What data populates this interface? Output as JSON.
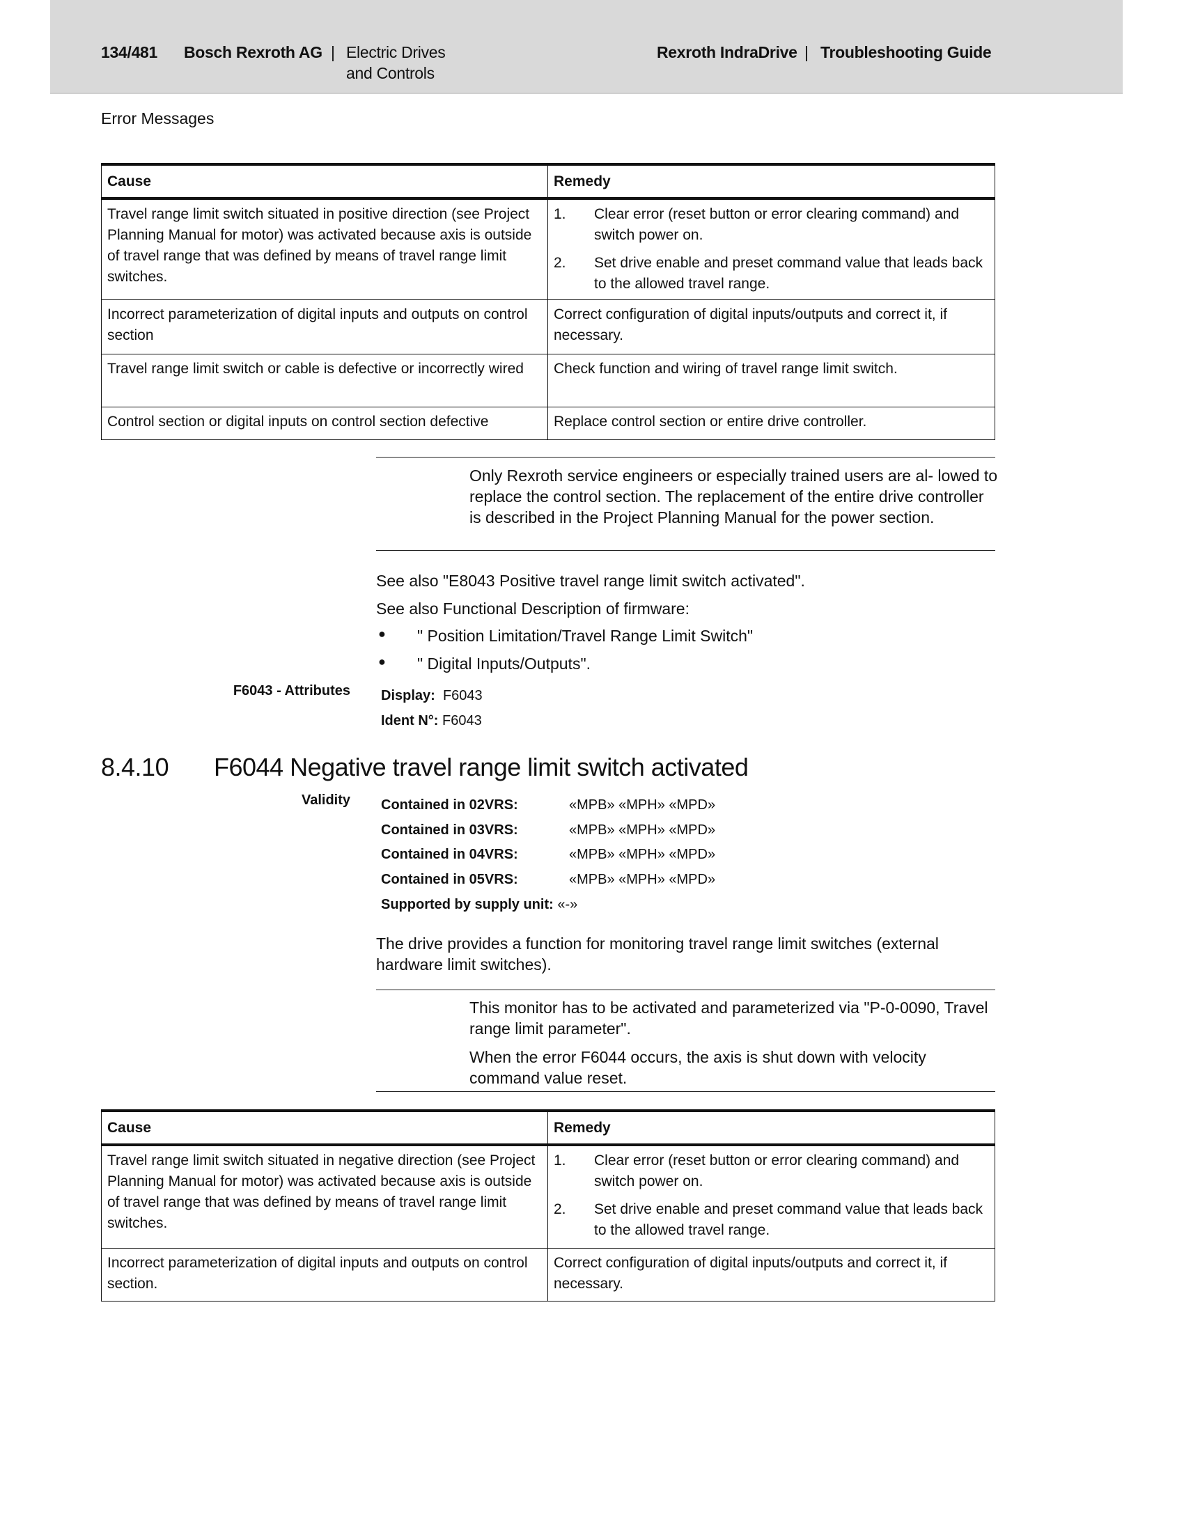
{
  "header": {
    "page": "134/481",
    "company": "Bosch Rexroth AG",
    "separator": "|",
    "division_line1": "Electric Drives",
    "division_line2": "and Controls",
    "product": "Rexroth IndraDrive",
    "doc_title": "Troubleshooting Guide"
  },
  "section_label": "Error Messages",
  "table1": {
    "headers": [
      "Cause",
      "Remedy"
    ],
    "rows": [
      {
        "cause": "Travel range limit switch situated in positive direction (see Project Planning Manual for motor) was activated because axis is outside of travel range that was defined by means of travel range limit switches.",
        "remedy_list": [
          {
            "num": "1.",
            "text": "Clear error (reset button or error clearing command) and switch power on."
          },
          {
            "num": "2.",
            "text": "Set drive enable and preset command value that leads back to the allowed travel range."
          }
        ]
      },
      {
        "cause": "Incorrect parameterization of digital inputs and outputs on control section",
        "remedy": "Correct configuration of digital inputs/outputs and correct it, if necessary."
      },
      {
        "cause": "Travel range limit switch or cable is defective or incorrectly wired",
        "remedy": "Check function and wiring of travel range limit switch."
      },
      {
        "cause": "Control section or digital inputs on control section defective",
        "remedy": "Replace control section or entire drive controller."
      }
    ]
  },
  "note1": "Only Rexroth service engineers or especially trained users are al- lowed to replace the control section. The replacement of the entire drive controller is described in the Project Planning Manual for the power section.",
  "see_also": [
    "See also \"E8043 Positive travel range limit switch activated\".",
    "See also Functional Description of firmware:"
  ],
  "bullets": [
    "\" Position Limitation/Travel Range Limit Switch\"",
    "\" Digital Inputs/Outputs\"."
  ],
  "bullet_glyph": "●",
  "attributes": {
    "label": "F6043 - Attributes",
    "display_label": "Display:",
    "display_value": "F6043",
    "ident_label": "Ident N°:",
    "ident_value": "F6043"
  },
  "heading": {
    "number": "8.4.10",
    "title": "F6044 Negative travel range limit switch activated"
  },
  "validity": {
    "label": "Validity",
    "rows": [
      {
        "key": "Contained in 02VRS:",
        "value": "«MPB» «MPH» «MPD»"
      },
      {
        "key": "Contained in 03VRS:",
        "value": "«MPB» «MPH» «MPD»"
      },
      {
        "key": "Contained in 04VRS:",
        "value": "«MPB» «MPH» «MPD»"
      },
      {
        "key": "Contained in 05VRS:",
        "value": "«MPB» «MPH» «MPD»"
      }
    ],
    "supply_key": "Supported by supply unit:",
    "supply_value": "«-»"
  },
  "description": "The drive provides a function for monitoring travel range limit switches (external hardware limit switches).",
  "note2": [
    "This monitor has to be activated and parameterized via \"P-0-0090, Travel range limit parameter\".",
    "When the error F6044 occurs, the axis is shut down with velocity command value reset."
  ],
  "table2": {
    "headers": [
      "Cause",
      "Remedy"
    ],
    "rows": [
      {
        "cause": "Travel range limit switch situated in negative direction (see Project Planning Manual for motor) was activated because axis is outside of travel range that was defined by means of travel range limit switches.",
        "remedy_list": [
          {
            "num": "1.",
            "text": "Clear error (reset button or error clearing command) and switch power on."
          },
          {
            "num": "2.",
            "text": "Set drive enable and preset command value that leads back to the allowed travel range."
          }
        ]
      },
      {
        "cause": "Incorrect parameterization of digital inputs and outputs on control section.",
        "remedy": "Correct configuration of digital inputs/outputs and correct it, if necessary."
      }
    ]
  }
}
